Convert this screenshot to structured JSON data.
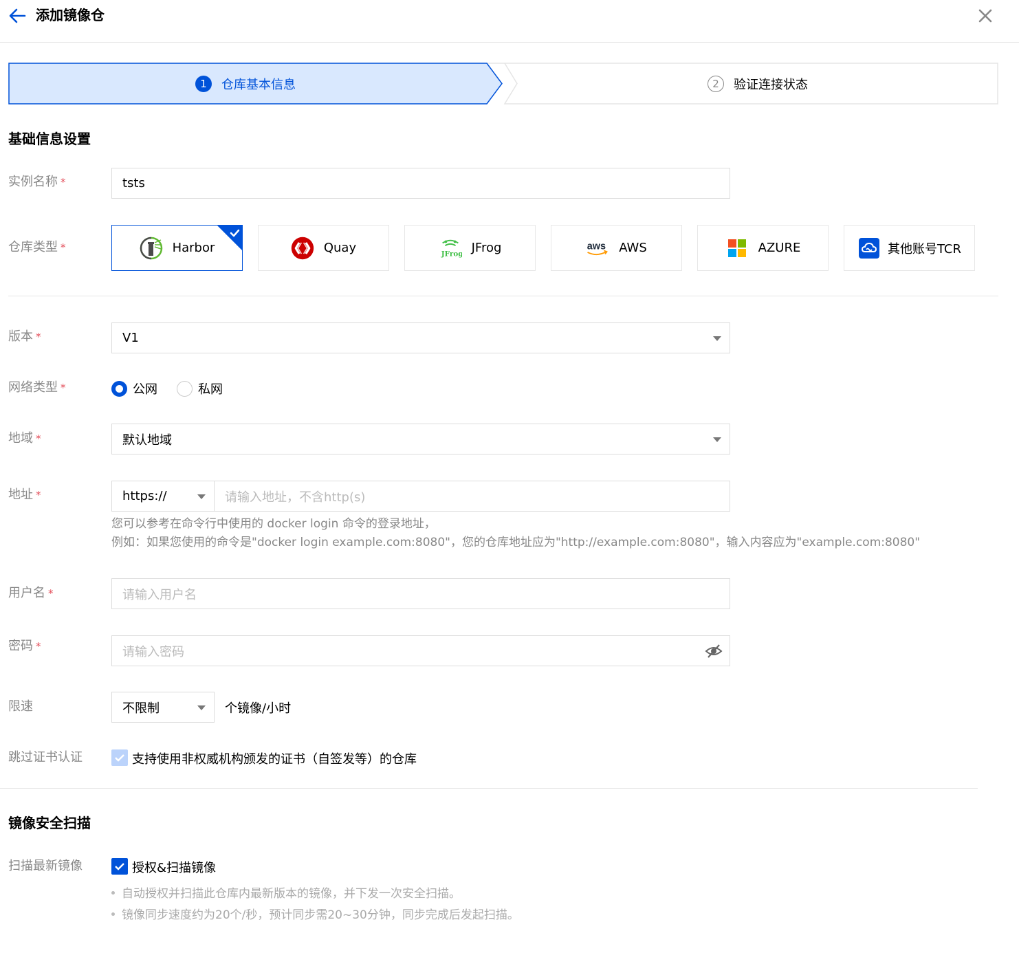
{
  "header": {
    "title": "添加镜像仓"
  },
  "steps": [
    {
      "num": "1",
      "label": "仓库基本信息"
    },
    {
      "num": "2",
      "label": "验证连接状态"
    }
  ],
  "basic": {
    "section_title": "基础信息设置",
    "instance_label": "实例名称",
    "instance_value": "tsts",
    "type_label": "仓库类型",
    "types": [
      {
        "label": "Harbor",
        "icon": "harbor-icon"
      },
      {
        "label": "Quay",
        "icon": "quay-icon"
      },
      {
        "label": "JFrog",
        "icon": "jfrog-icon"
      },
      {
        "label": "AWS",
        "icon": "aws-icon"
      },
      {
        "label": "AZURE",
        "icon": "azure-icon"
      },
      {
        "label": "其他账号TCR",
        "icon": "tcr-cloud-icon"
      }
    ],
    "selected_type": "Harbor",
    "jfrog_logo_text": "JFrog",
    "aws_logo_text": "aws",
    "version_label": "版本",
    "version_value": "V1",
    "network_label": "网络类型",
    "network_options": [
      "公网",
      "私网"
    ],
    "network_selected": "公网",
    "region_label": "地域",
    "region_value": "默认地域",
    "address_label": "地址",
    "protocol_value": "https://",
    "address_placeholder": "请输入地址，不含http(s)",
    "address_help_1": "您可以参考在命令行中使用的 docker login 命令的登录地址，",
    "address_help_2": "例如：如果您使用的命令是\"docker login example.com:8080\"，您的仓库地址应为\"http://example.com:8080\"，输入内容应为\"example.com:8080\"",
    "username_label": "用户名",
    "username_placeholder": "请输入用户名",
    "password_label": "密码",
    "password_placeholder": "请输入密码",
    "rate_label": "限速",
    "rate_value": "不限制",
    "rate_unit": "个镜像/小时",
    "skip_cert_label": "跳过证书认证",
    "skip_cert_text": "支持使用非权威机构颁发的证书（自签发等）的仓库",
    "skip_cert_checked": true
  },
  "scan": {
    "section_title": "镜像安全扫描",
    "scan_label": "扫描最新镜像",
    "scan_checkbox_text": "授权&扫描镜像",
    "scan_checked": true,
    "bullets": [
      "自动授权并扫描此仓库内最新版本的镜像，并下发一次安全扫描。",
      "镜像同步速度约为20个/秒，预计同步需20~30分钟，同步完成后发起扫描。"
    ]
  },
  "colors": {
    "primary": "#0052d9",
    "required": "#e34d59",
    "step_active_bg": "#d9e8fe",
    "checkbox_disabled": "#bbd3fb"
  }
}
